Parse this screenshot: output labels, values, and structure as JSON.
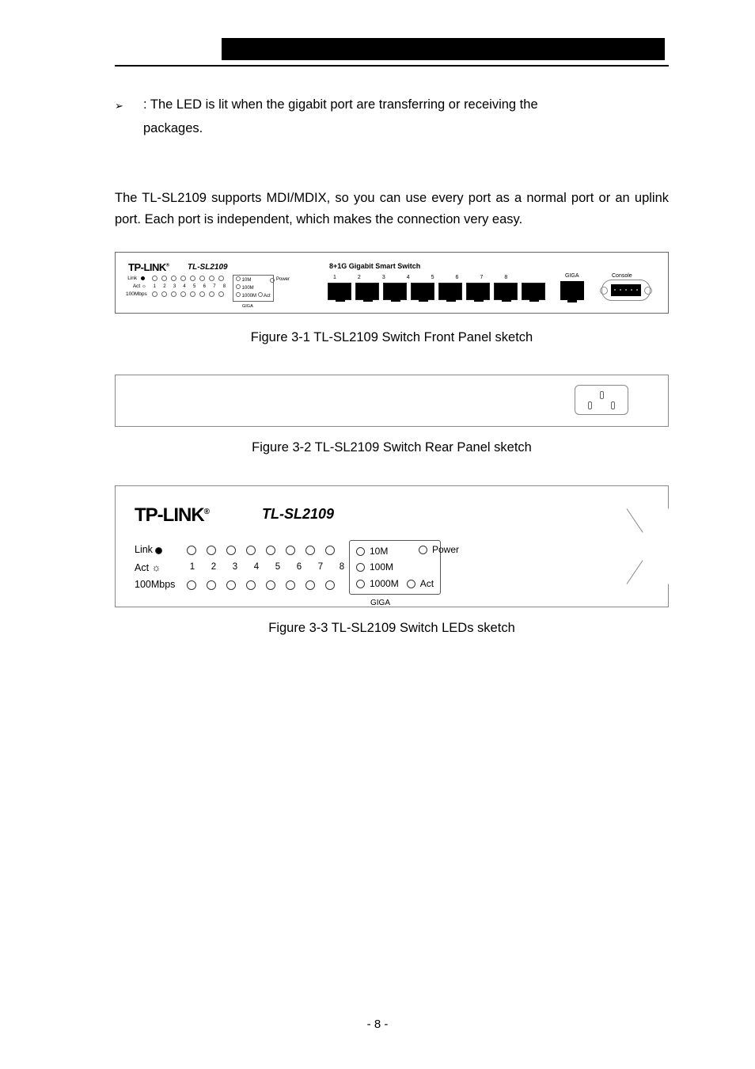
{
  "bullet": {
    "symbol": "➢",
    "text_line1": ": The LED is lit when the gigabit port are transferring or receiving the",
    "text_line2": "packages."
  },
  "section_para": "The TL-SL2109 supports MDI/MDIX, so you can use every port as a normal port or an uplink port. Each port is independent, which makes the connection very easy.",
  "captions": {
    "fig1": "Figure 3-1 TL-SL2109 Switch Front Panel sketch",
    "fig2": "Figure 3-2 TL-SL2109 Switch Rear Panel sketch",
    "fig3": "Figure 3-3 TL-SL2109 Switch LEDs sketch"
  },
  "front_panel": {
    "brand": "TP-LINK",
    "reg": "®",
    "model": "TL-SL2109",
    "desc": "8+1G Gigabit Smart Switch",
    "led_labels": {
      "link": "Link",
      "act": "Act",
      "mbps": "100Mbps"
    },
    "nums": [
      "1",
      "2",
      "3",
      "4",
      "5",
      "6",
      "7",
      "8"
    ],
    "giga_lines": [
      "10M",
      "100M",
      "1000M"
    ],
    "giga_act": "Act",
    "giga_label": "GIGA",
    "power": "Power",
    "port_nums": [
      "1",
      "2",
      "3",
      "4",
      "5",
      "6",
      "7",
      "8"
    ],
    "giga_text": "GIGA",
    "console_text": "Console"
  },
  "led_panel": {
    "brand": "TP-LINK",
    "reg": "®",
    "model": "TL-SL2109",
    "rows": {
      "link": "Link",
      "act": "Act",
      "mbps": "100Mbps"
    },
    "sun": "☼",
    "nums": [
      "1",
      "2",
      "3",
      "4",
      "5",
      "6",
      "7",
      "8"
    ],
    "box": {
      "l10": "10M",
      "l100": "100M",
      "l1000": "1000M",
      "act": "Act"
    },
    "power": "Power",
    "giga": "GIGA"
  },
  "page_num": "- 8 -"
}
